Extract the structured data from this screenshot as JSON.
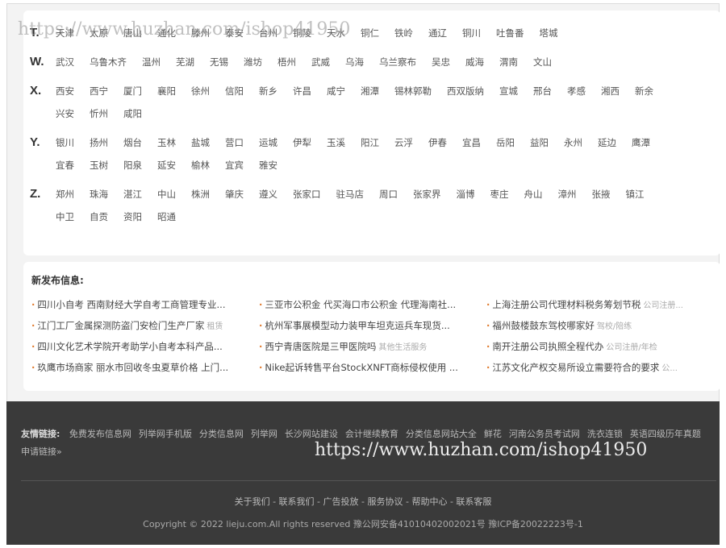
{
  "cities": [
    {
      "letter": "T.",
      "items": [
        "天津",
        "太原",
        "唐山",
        "通化",
        "滕州",
        "泰安",
        "台州",
        "铜陵",
        "天水",
        "铜仁",
        "铁岭",
        "通辽",
        "铜川",
        "吐鲁番",
        "塔城"
      ]
    },
    {
      "letter": "W.",
      "items": [
        "武汉",
        "乌鲁木齐",
        "温州",
        "芜湖",
        "无锡",
        "潍坊",
        "梧州",
        "武威",
        "乌海",
        "乌兰察布",
        "吴忠",
        "威海",
        "渭南",
        "文山"
      ]
    },
    {
      "letter": "X.",
      "items": [
        "西安",
        "西宁",
        "厦门",
        "襄阳",
        "徐州",
        "信阳",
        "新乡",
        "许昌",
        "咸宁",
        "湘潭",
        "锡林郭勒",
        "西双版纳",
        "宣城",
        "邢台",
        "孝感",
        "湘西",
        "新余",
        "兴安",
        "忻州",
        "咸阳"
      ]
    },
    {
      "letter": "Y.",
      "items": [
        "银川",
        "扬州",
        "烟台",
        "玉林",
        "盐城",
        "营口",
        "运城",
        "伊犁",
        "玉溪",
        "阳江",
        "云浮",
        "伊春",
        "宜昌",
        "岳阳",
        "益阳",
        "永州",
        "延边",
        "鹰潭",
        "宜春",
        "玉树",
        "阳泉",
        "延安",
        "榆林",
        "宜宾",
        "雅安"
      ]
    },
    {
      "letter": "Z.",
      "items": [
        "郑州",
        "珠海",
        "湛江",
        "中山",
        "株洲",
        "肇庆",
        "遵义",
        "张家口",
        "驻马店",
        "周口",
        "张家界",
        "淄博",
        "枣庄",
        "舟山",
        "漳州",
        "张掖",
        "镇江",
        "中卫",
        "自贡",
        "资阳",
        "昭通"
      ]
    }
  ],
  "news": {
    "title": "新发布信息:",
    "items": [
      {
        "text": "四川小自考 西南财经大学自考工商管理专业...",
        "tag": ""
      },
      {
        "text": "三亚市公积金 代买海口市公积金 代理海南社...",
        "tag": ""
      },
      {
        "text": "上海注册公司代理材料税务筹划节税",
        "tag": "公司注册..."
      },
      {
        "text": "江门工厂金属探测防盗门安检门生产厂家",
        "tag": "租赁"
      },
      {
        "text": "杭州军事展模型动力装甲车坦克运兵车现货...",
        "tag": ""
      },
      {
        "text": "福州鼓楼鼓东驾校哪家好",
        "tag": "驾校/陪练"
      },
      {
        "text": "四川文化艺术学院开考助学小自考本科产品...",
        "tag": ""
      },
      {
        "text": "西宁青唐医院是三甲医院吗",
        "tag": "其他生活服务"
      },
      {
        "text": "南开注册公司执照全程代办",
        "tag": "公司注册/年检"
      },
      {
        "text": "玖鹰市场商家 丽水市回收冬虫夏草价格 上门...",
        "tag": ""
      },
      {
        "text": "Nike起诉转售平台StockXNFT商标侵权使用 ...",
        "tag": ""
      },
      {
        "text": "江苏文化产权交易所设立需要符合的要求",
        "tag": "公..."
      }
    ]
  },
  "footer": {
    "links_label": "友情链接:",
    "links": [
      "免费发布信息网",
      "列举网手机版",
      "分类信息网",
      "列举网",
      "长沙网站建设",
      "会计继续教育",
      "分类信息网站大全",
      "鲜花",
      "河南公务员考试网",
      "洗衣连锁",
      "英语四级历年真题",
      "申请链接»"
    ],
    "nav": [
      "关于我们",
      "联系我们",
      "广告投放",
      "服务协议",
      "帮助中心",
      "联系客服"
    ],
    "copyright": "Copyright © 2022 lieju.com.All rights reserved 豫公网安备41010402002021号 豫ICP备20022223号-1"
  },
  "watermark": {
    "top": "https://www.huzhan.com/ishop41950",
    "bottom": "https://www.huzhan.com/ishop41950"
  }
}
